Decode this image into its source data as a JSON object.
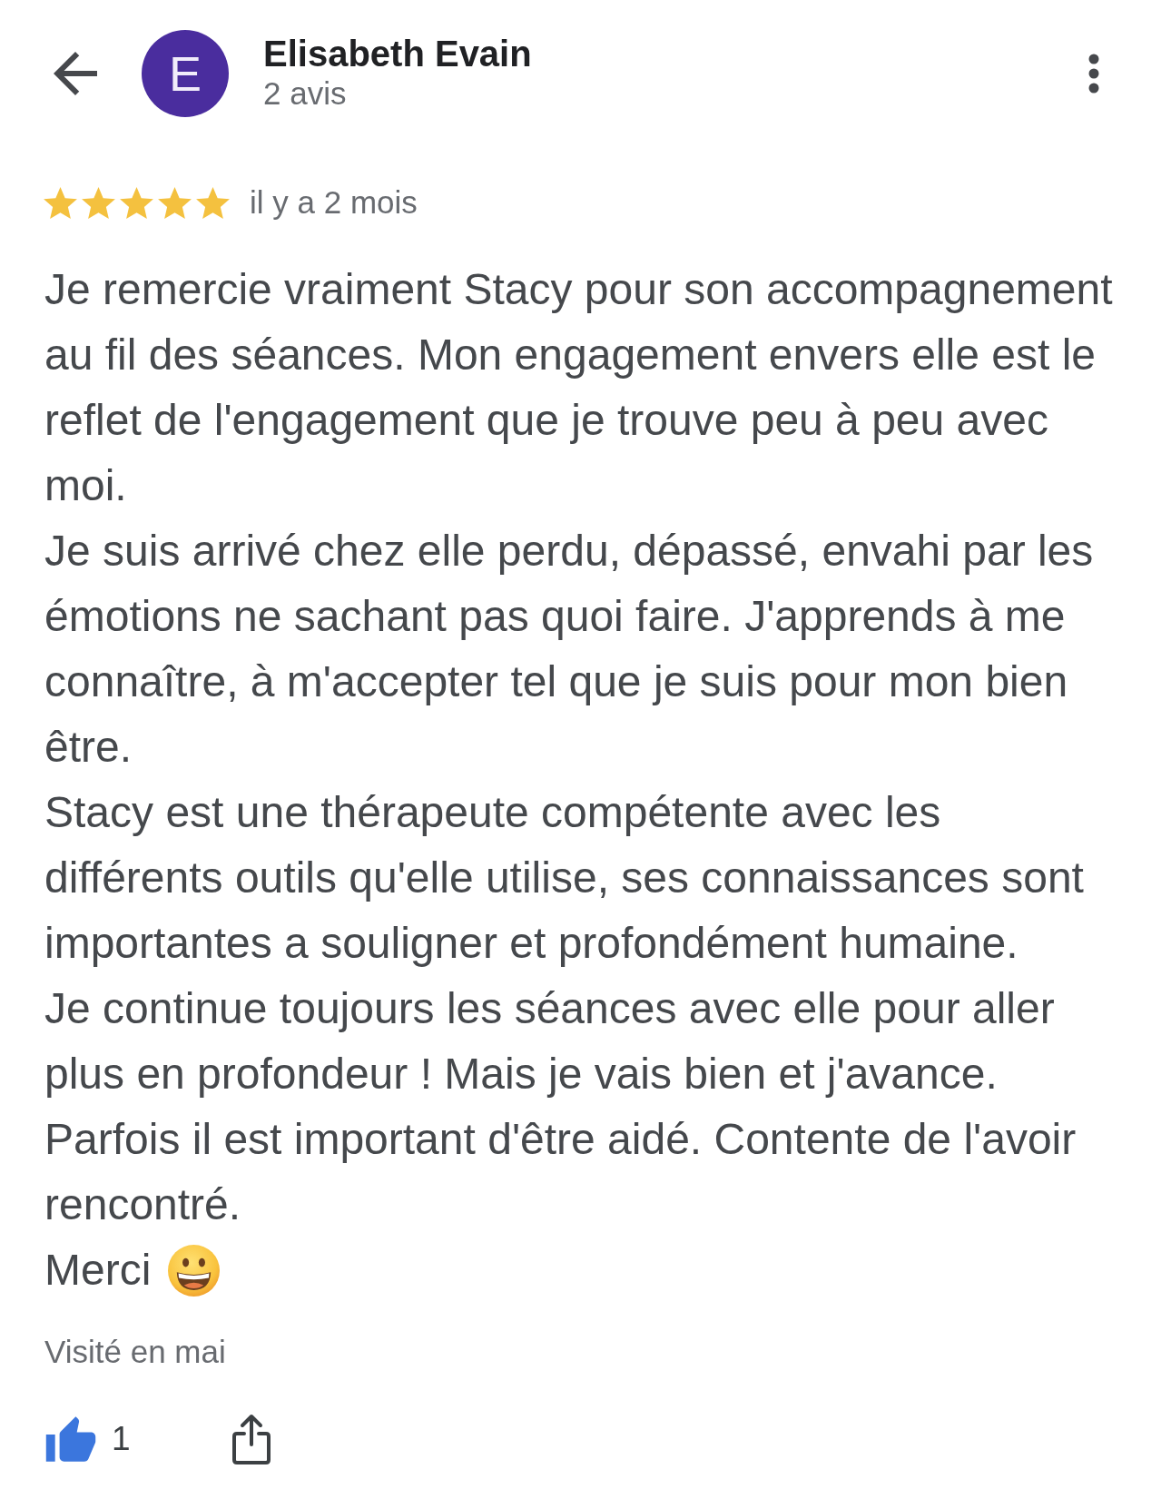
{
  "reviewer": {
    "avatar_letter": "E",
    "name": "Elisabeth Evain",
    "review_count": "2 avis"
  },
  "review": {
    "stars": 5,
    "time": "il y a 2 mois",
    "text": "Je remercie vraiment Stacy pour son accompagnement au fil des séances. Mon engagement envers elle est le reflet de l'engagement que je trouve peu à peu avec moi.\nJe suis arrivé chez elle perdu, dépassé, envahi par les émotions ne sachant pas quoi faire. J'apprends à me connaître, à m'accepter tel que je suis pour mon bien être.\nStacy est une thérapeute compétente avec les différents outils qu'elle utilise, ses connaissances sont importantes a souligner et profondément humaine.\nJe continue toujours les séances avec elle pour aller plus en profondeur ! Mais je vais bien et j'avance. Parfois il est important d'être aidé. Contente de l'avoir rencontré.",
    "closing": "Merci",
    "visit": "Visité en mai"
  },
  "actions": {
    "likes": "1",
    "liked": true
  }
}
